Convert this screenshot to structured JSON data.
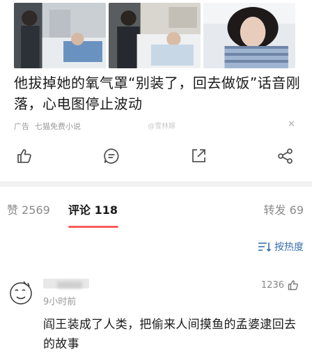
{
  "ad": {
    "headline": "他拔掉她的氧气罩“别装了，回去做饭”话音刚落，心电图停止波动",
    "tag": "广告",
    "source": "七猫免费小说",
    "close_label": "✕",
    "watermark": "@雪林嫁",
    "images": [
      "hospital-scene-1",
      "hospital-scene-2",
      "hospital-scene-3"
    ]
  },
  "actions": {
    "icons": [
      "thumbs-up-icon",
      "comment-icon",
      "share-external-icon",
      "share-network-icon"
    ]
  },
  "tabs": {
    "likes": "赞 2569",
    "comments": "评论 118",
    "reposts": "转发 69"
  },
  "sort": {
    "label": "按热度"
  },
  "comment": {
    "time": "9小时前",
    "likes": "1236",
    "text": "阎王装成了人类，把偷来人间摸鱼的孟婆逮回去的故事"
  },
  "colors": {
    "accent": "#ff5d5b",
    "link": "#3a6fb0"
  }
}
